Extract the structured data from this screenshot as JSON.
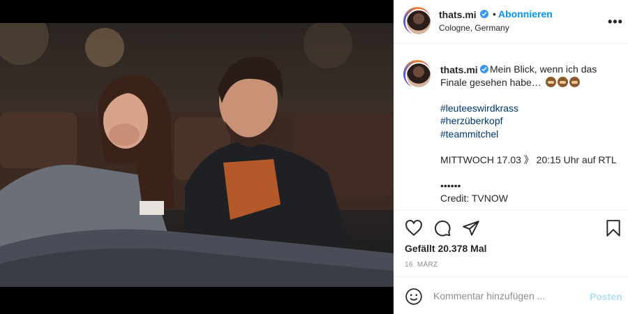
{
  "post": {
    "username": "thats.mi",
    "follow_label": "Abonnieren",
    "separator": "•",
    "location": "Cologne, Germany",
    "more_icon": "more-horizontal-icon"
  },
  "caption": {
    "username": "thats.mi",
    "lines": [
      "Mein Blick, wenn ich das",
      "Finale gesehen habe…",
      "",
      "#leuteeswirdkrass",
      "#herzüberkopf",
      "#teammitchel",
      "",
      "MITTWOCH 17.03 》 20:15 Uhr auf RTL",
      "",
      "••••••",
      "Credit: TVNOW"
    ]
  },
  "actions": {
    "icons": [
      "heart-icon",
      "comment-icon",
      "share-icon",
      "bookmark-icon"
    ],
    "likes": "Gefällt 20.378 Mal",
    "date": "16. MÄRZ"
  },
  "comment": {
    "placeholder": "Kommentar hinzufügen ...",
    "post_label": "Posten"
  },
  "colors": {
    "accent": "#0095f6",
    "verified": "#3897f0",
    "hashtag": "#00376b",
    "post_disabled": "#b2dffc"
  }
}
